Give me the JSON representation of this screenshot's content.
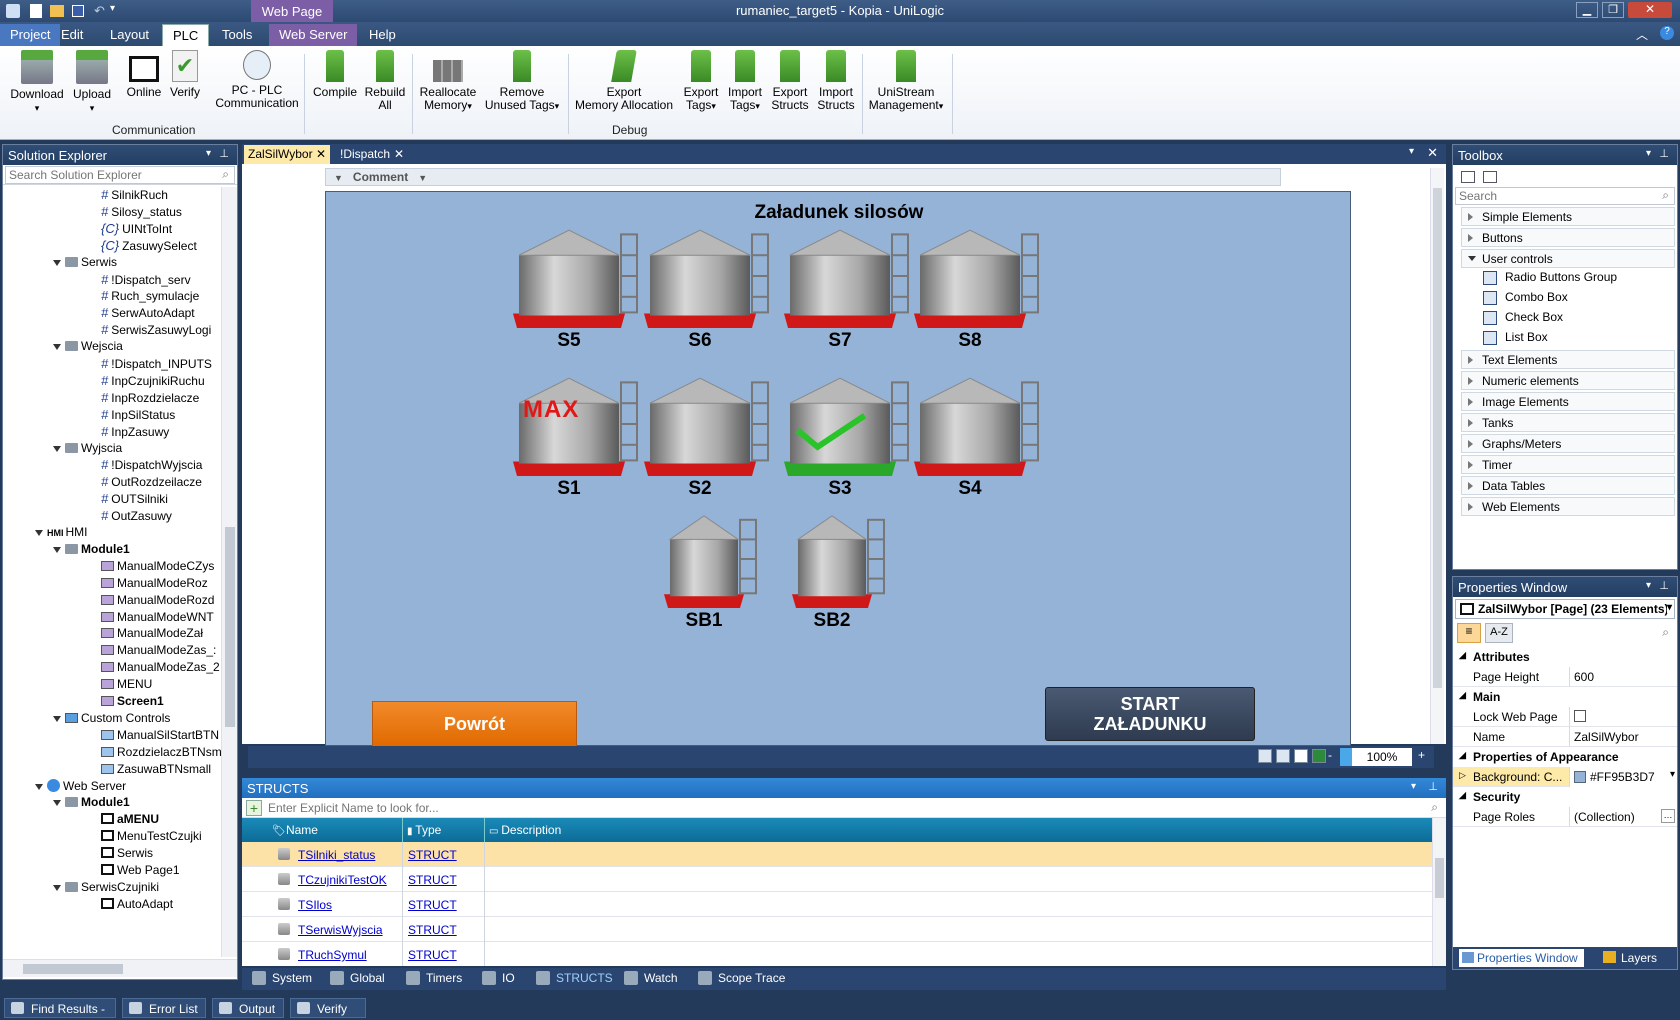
{
  "title": "rumaniec_target5 - Kopia - UniLogic",
  "context_tab": "Web Page",
  "ribbon_tabs": [
    "Project",
    "Edit",
    "Layout",
    "PLC",
    "Tools",
    "Web Server",
    "Help"
  ],
  "ribbon": {
    "download": "Download",
    "upload": "Upload",
    "online": "Online",
    "verify": "Verify",
    "pc_plc_1": "PC - PLC",
    "pc_plc_2": "Communication",
    "compile": "Compile",
    "rebuild_1": "Rebuild",
    "rebuild_2": "All",
    "reallocate_1": "Reallocate",
    "reallocate_2": "Memory",
    "remove_1": "Remove",
    "remove_2": "Unused Tags",
    "export_mem_1": "Export",
    "export_mem_2": "Memory Allocation",
    "export_tags_1": "Export",
    "export_tags_2": "Tags",
    "import_tags_1": "Import",
    "import_tags_2": "Tags",
    "export_structs_1": "Export",
    "export_structs_2": "Structs",
    "import_structs_1": "Import",
    "import_structs_2": "Structs",
    "unistream_1": "UniStream",
    "unistream_2": "Management",
    "group_communication": "Communication",
    "group_debug": "Debug"
  },
  "solution_explorer": {
    "title": "Solution Explorer",
    "search_placeholder": "Search Solution Explorer",
    "items": [
      {
        "label": "SilnikRuch",
        "type": "hash",
        "indent": 3
      },
      {
        "label": "Silosy_status",
        "type": "hash",
        "indent": 3
      },
      {
        "label": "UINtToInt",
        "type": "c",
        "indent": 3
      },
      {
        "label": "ZasuwySelect",
        "type": "c",
        "indent": 3
      },
      {
        "label": "Serwis",
        "type": "folder",
        "indent": 2
      },
      {
        "label": "!Dispatch_serv",
        "type": "hash",
        "indent": 3
      },
      {
        "label": "Ruch_symulacje",
        "type": "hash",
        "indent": 3
      },
      {
        "label": "SerwAutoAdapt",
        "type": "hash",
        "indent": 3
      },
      {
        "label": "SerwisZasuwyLogi",
        "type": "hash",
        "indent": 3
      },
      {
        "label": "Wejscia",
        "type": "folder",
        "indent": 2
      },
      {
        "label": "!Dispatch_INPUTS",
        "type": "hash",
        "indent": 3
      },
      {
        "label": "InpCzujnikiRuchu",
        "type": "hash",
        "indent": 3
      },
      {
        "label": "InpRozdzielacze",
        "type": "hash",
        "indent": 3
      },
      {
        "label": "InpSilStatus",
        "type": "hash",
        "indent": 3
      },
      {
        "label": "InpZasuwy",
        "type": "hash",
        "indent": 3
      },
      {
        "label": "Wyjscia",
        "type": "folder",
        "indent": 2
      },
      {
        "label": "!DispatchWyjscia",
        "type": "hash",
        "indent": 3
      },
      {
        "label": "OutRozdzeilacze",
        "type": "hash",
        "indent": 3
      },
      {
        "label": "OUTSilniki",
        "type": "hash",
        "indent": 3
      },
      {
        "label": "OutZasuwy",
        "type": "hash",
        "indent": 3
      },
      {
        "label": "HMI",
        "type": "hmi",
        "indent": 1
      },
      {
        "label": "Module1",
        "type": "folder-bold",
        "indent": 2
      },
      {
        "label": "ManualModeCZys",
        "type": "screen",
        "indent": 3
      },
      {
        "label": "ManualModeRoz",
        "type": "screen",
        "indent": 3
      },
      {
        "label": "ManualModeRozd",
        "type": "screen",
        "indent": 3
      },
      {
        "label": "ManualModeWNT",
        "type": "screen",
        "indent": 3
      },
      {
        "label": "ManualModeZał",
        "type": "screen",
        "indent": 3
      },
      {
        "label": "ManualModeZas_:",
        "type": "screen",
        "indent": 3
      },
      {
        "label": "ManualModeZas_2",
        "type": "screen",
        "indent": 3
      },
      {
        "label": "MENU",
        "type": "screen",
        "indent": 3
      },
      {
        "label": "Screen1",
        "type": "screen-bold",
        "indent": 3
      },
      {
        "label": "Custom Controls",
        "type": "cc",
        "indent": 2
      },
      {
        "label": "ManualSilStartBTN",
        "type": "ccitem",
        "indent": 3
      },
      {
        "label": "RozdzielaczBTNsm",
        "type": "ccitem",
        "indent": 3
      },
      {
        "label": "ZasuwaBTNsmall",
        "type": "ccitem",
        "indent": 3
      },
      {
        "label": "Web Server",
        "type": "globe",
        "indent": 1
      },
      {
        "label": "Module1",
        "type": "folder-bold",
        "indent": 2
      },
      {
        "label": "aMENU",
        "type": "mon-bold",
        "indent": 3
      },
      {
        "label": "MenuTestCzujki",
        "type": "mon",
        "indent": 3
      },
      {
        "label": "Serwis",
        "type": "mon",
        "indent": 3
      },
      {
        "label": "Web Page1",
        "type": "mon",
        "indent": 3
      },
      {
        "label": "SerwisCzujniki",
        "type": "folder",
        "indent": 2
      },
      {
        "label": "AutoAdapt",
        "type": "mon",
        "indent": 3
      }
    ]
  },
  "doc_tabs": [
    "ZalSilWybor",
    "!Dispatch"
  ],
  "comment_label": "Comment",
  "hmi": {
    "title": "Załadunek silosów",
    "silos": [
      {
        "label": "S5",
        "state": "normal"
      },
      {
        "label": "S6",
        "state": "normal"
      },
      {
        "label": "S7",
        "state": "normal"
      },
      {
        "label": "S8",
        "state": "normal"
      },
      {
        "label": "S1",
        "state": "max"
      },
      {
        "label": "S2",
        "state": "normal"
      },
      {
        "label": "S3",
        "state": "ok"
      },
      {
        "label": "S4",
        "state": "normal"
      },
      {
        "label": "SB1",
        "state": "normal"
      },
      {
        "label": "SB2",
        "state": "normal"
      }
    ],
    "max_text": "MAX",
    "back_button": "Powrót",
    "start_button_1": "START",
    "start_button_2": "ZAŁADUNKU",
    "zoom": "100%"
  },
  "structs": {
    "title": "STRUCTS",
    "search_placeholder": "Enter Explicit Name to look for...",
    "columns": [
      "Name",
      "Type",
      "Description"
    ],
    "rows": [
      {
        "name": "TSilniki_status",
        "type": "STRUCT",
        "description": ""
      },
      {
        "name": "TCzujnikiTestOK",
        "type": "STRUCT",
        "description": ""
      },
      {
        "name": "TSIlos",
        "type": "STRUCT",
        "description": ""
      },
      {
        "name": "TSerwisWyjscia",
        "type": "STRUCT",
        "description": ""
      },
      {
        "name": "TRuchSymul",
        "type": "STRUCT",
        "description": ""
      }
    ]
  },
  "bottom_tabs": [
    "System",
    "Global",
    "Timers",
    "IO",
    "STRUCTS",
    "Watch",
    "Scope Trace"
  ],
  "toolbox": {
    "title": "Toolbox",
    "search_placeholder": "Search",
    "categories": [
      "Simple Elements",
      "Buttons",
      "User controls",
      "Text Elements",
      "Numeric elements",
      "Image Elements",
      "Tanks",
      "Graphs/Meters",
      "Timer",
      "Data Tables",
      "Web Elements"
    ],
    "user_controls": [
      "Radio Buttons Group",
      "Combo Box",
      "Check Box",
      "List Box"
    ]
  },
  "properties": {
    "title": "Properties Window",
    "selector": "ZalSilWybor [Page] (23 Elements)",
    "az": "A-Z",
    "sections": {
      "attributes": "Attributes",
      "main": "Main",
      "appearance": "Properties of Appearance",
      "security": "Security"
    },
    "page_height_label": "Page Height",
    "page_height_value": "600",
    "lock_label": "Lock Web Page",
    "name_label": "Name",
    "name_value": "ZalSilWybor",
    "background_label": "Background: C...",
    "background_value": "#FF95B3D7",
    "roles_label": "Page Roles",
    "roles_value": "(Collection)",
    "footer_tabs": [
      "Properties Window",
      "Layers"
    ]
  },
  "status_tabs": [
    "Find Results -",
    "Error List",
    "Output",
    "Verify"
  ],
  "colors": {
    "hmi_bg": "#95b3d7",
    "accent": "#2f4d76",
    "orange": "#e8700c",
    "ribbon_purple": "#7b5ea6"
  }
}
